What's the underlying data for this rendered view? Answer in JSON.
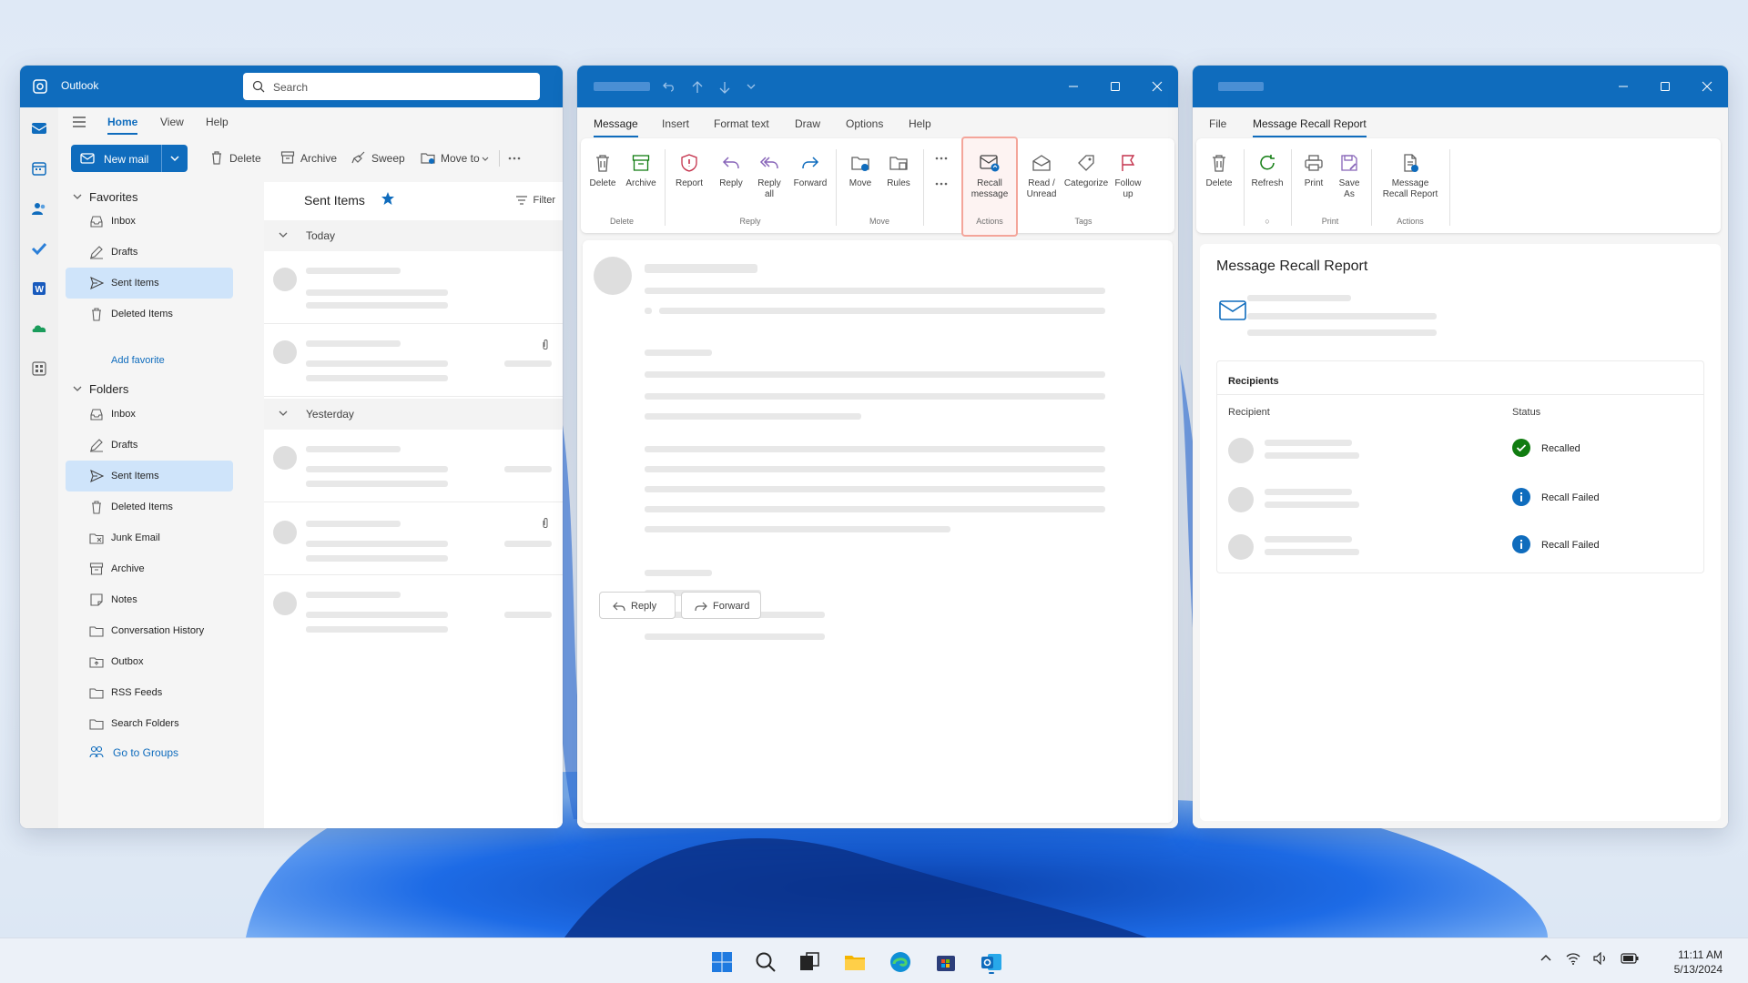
{
  "outlook": {
    "app_name": "Outlook",
    "search_placeholder": "Search",
    "tabs": [
      "Home",
      "View",
      "Help"
    ],
    "new_mail": "New mail",
    "toolbar": {
      "delete": "Delete",
      "archive": "Archive",
      "sweep": "Sweep",
      "move_to": "Move to"
    },
    "favorites": {
      "header": "Favorites",
      "items": [
        "Inbox",
        "Drafts",
        "Sent Items",
        "Deleted Items"
      ],
      "add_favorite": "Add favorite"
    },
    "folders": {
      "header": "Folders",
      "items": [
        "Inbox",
        "Drafts",
        "Sent Items",
        "Deleted Items",
        "Junk Email",
        "Archive",
        "Notes",
        "Conversation History",
        "Outbox",
        "RSS Feeds",
        "Search Folders"
      ],
      "go_to_groups": "Go to Groups"
    },
    "message_list": {
      "title": "Sent Items",
      "filter": "Filter",
      "groups": [
        "Today",
        "Yesterday"
      ]
    }
  },
  "message_window": {
    "tabs": [
      "Message",
      "Insert",
      "Format text",
      "Draw",
      "Options",
      "Help"
    ],
    "ribbon": {
      "delete": "Delete",
      "archive": "Archive",
      "report": "Report",
      "reply": "Reply",
      "reply_all_1": "Reply",
      "reply_all_2": "all",
      "forward": "Forward",
      "move": "Move",
      "rules": "Rules",
      "recall_1": "Recall",
      "recall_2": "message",
      "read_unread_1": "Read /",
      "read_unread_2": "Unread",
      "categorize": "Categorize",
      "follow_up_1": "Follow",
      "follow_up_2": "up",
      "groups": {
        "delete": "Delete",
        "reply": "Reply",
        "move": "Move",
        "actions": "Actions",
        "tags": "Tags"
      }
    },
    "reply_button": "Reply",
    "forward_button": "Forward"
  },
  "recall_window": {
    "tabs": [
      "File",
      "Message Recall Report"
    ],
    "ribbon": {
      "delete": "Delete",
      "refresh": "Refresh",
      "print": "Print",
      "save_as_1": "Save",
      "save_as_2": "As",
      "report_1": "Message",
      "report_2": "Recall Report",
      "groups": {
        "print": "Print",
        "actions": "Actions"
      }
    },
    "title": "Message Recall Report",
    "recipients_header": "Recipients",
    "col_recipient": "Recipient",
    "col_status": "Status",
    "rows": [
      {
        "status": "Recalled",
        "color": "#107c10"
      },
      {
        "status": "Recall Failed",
        "color": "#0f6cbd"
      },
      {
        "status": "Recall Failed",
        "color": "#0f6cbd"
      }
    ]
  },
  "taskbar": {
    "time": "11:11 AM",
    "date": "5/13/2024"
  },
  "colors": {
    "accent": "#0f6cbd",
    "selected": "#cfe4fa",
    "success": "#107c10"
  }
}
